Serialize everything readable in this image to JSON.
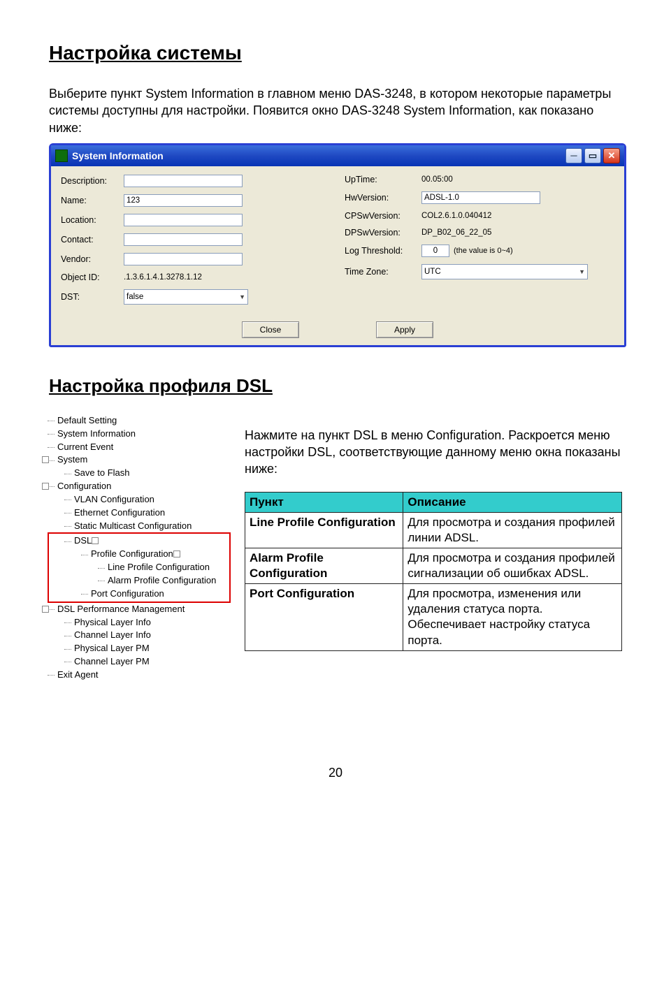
{
  "heading1": "Настройка системы",
  "intro1": "Выберите пункт System Information в главном меню DAS-3248, в котором некоторые параметры системы доступны для настройки. Появится окно DAS-3248 System Information, как показано ниже:",
  "sysinfo": {
    "title": "System Information",
    "left_labels": {
      "description": "Description:",
      "name": "Name:",
      "location": "Location:",
      "contact": "Contact:",
      "vendor": "Vendor:",
      "object_id": "Object ID:",
      "dst": "DST:"
    },
    "left_values": {
      "description": "",
      "name": "123",
      "location": "",
      "contact": "",
      "vendor": "",
      "object_id": ".1.3.6.1.4.1.3278.1.12",
      "dst": "false"
    },
    "right_labels": {
      "uptime": "UpTime:",
      "hwversion": "HwVersion:",
      "cpsw": "CPSwVersion:",
      "dpsw": "DPSwVersion:",
      "logth": "Log Threshold:",
      "tz": "Time Zone:"
    },
    "right_values": {
      "uptime": "00.05:00",
      "hwversion": "ADSL-1.0",
      "cpsw": "COL2.6.1.0.040412",
      "dpsw": "DP_B02_06_22_05",
      "logth": "0",
      "logth_note": "(the value is 0~4)",
      "tz": "UTC"
    },
    "buttons": {
      "close": "Close",
      "apply": "Apply"
    }
  },
  "heading2": "Настройка профиля DSL",
  "tree": {
    "items": [
      "Default Setting",
      "System Information",
      "Current Event",
      "System",
      "Save to Flash",
      "Configuration",
      "VLAN Configuration",
      "Ethernet Configuration",
      "Static Multicast Configuration",
      "DSL",
      "Profile Configuration",
      "Line Profile Configuration",
      "Alarm Profile Configuration",
      "Port Configuration",
      "DSL Performance Management",
      "Physical Layer Info",
      "Channel Layer Info",
      "Physical Layer PM",
      "Channel Layer PM",
      "Exit Agent"
    ]
  },
  "right_para": "Нажмите на пункт DSL в меню Configuration. Раскроется меню настройки DSL, соответствующие данному меню окна показаны ниже:",
  "table": {
    "head1": "Пункт",
    "head2": "Описание",
    "rows": [
      {
        "c1": " Line Profile Configuration",
        "c2": "Для просмотра и создания профилей линии ADSL."
      },
      {
        "c1": " Alarm Profile Configuration",
        "c2": "Для просмотра и создания профилей сигнализации об ошибках ADSL."
      },
      {
        "c1": "Port Configuration",
        "c2": "Для просмотра, изменения или удаления статуса порта. Обеспечивает настройку статуса порта."
      }
    ]
  },
  "page_number": "20"
}
